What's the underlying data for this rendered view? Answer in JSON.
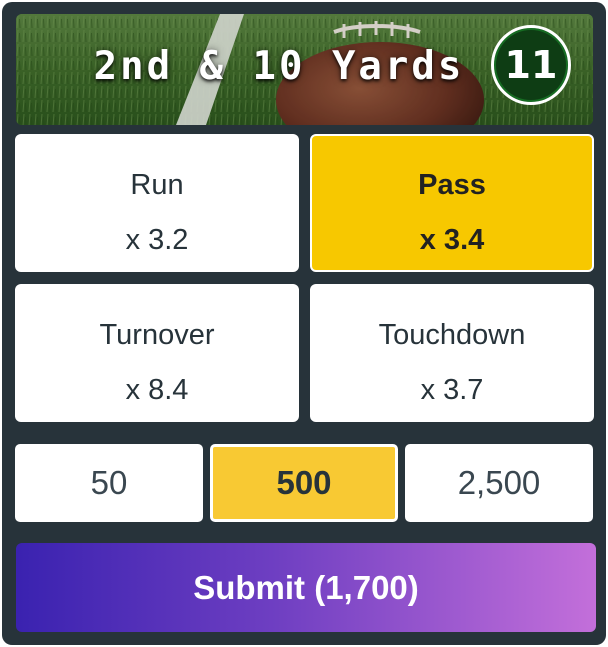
{
  "header": {
    "title": "2nd & 10 Yards",
    "down_number": "11"
  },
  "options": [
    {
      "label": "Run",
      "multiplier": "x 3.2",
      "selected": false
    },
    {
      "label": "Pass",
      "multiplier": "x 3.4",
      "selected": true
    },
    {
      "label": "Turnover",
      "multiplier": "x 8.4",
      "selected": false
    },
    {
      "label": "Touchdown",
      "multiplier": "x 3.7",
      "selected": false
    }
  ],
  "amounts": [
    {
      "label": "50",
      "selected": false
    },
    {
      "label": "500",
      "selected": true
    },
    {
      "label": "2,500",
      "selected": false
    }
  ],
  "submit": {
    "label": "Submit (1,700)"
  },
  "colors": {
    "background": "#27333a",
    "selected_option": "#f7c800",
    "selected_amount": "#f8c933",
    "submit_gradient_start": "#3a22b0",
    "submit_gradient_end": "#c36fda",
    "badge_green": "#0e3d14"
  },
  "icons": {
    "header_background": "football-on-grass-image"
  }
}
